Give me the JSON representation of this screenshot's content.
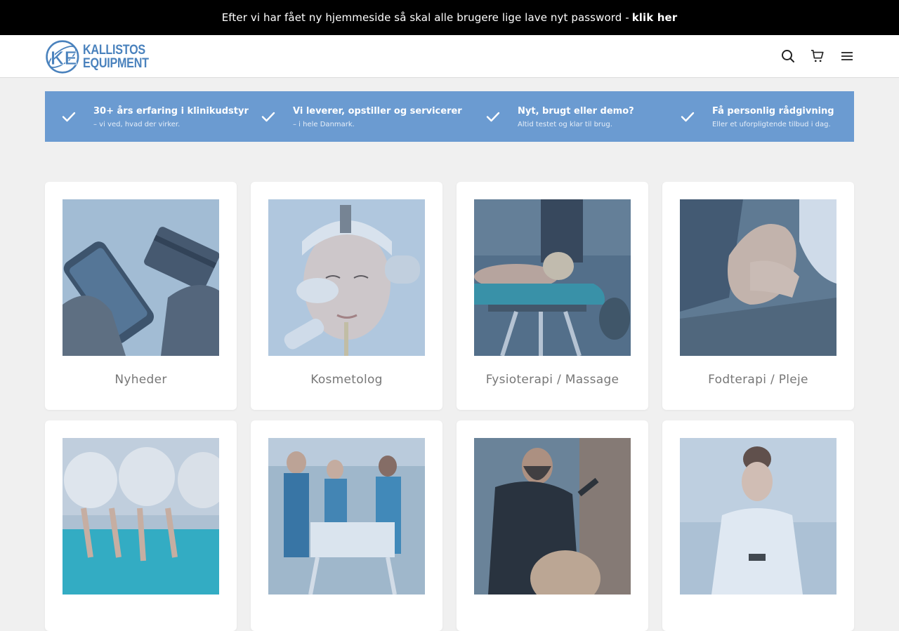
{
  "announcement": {
    "text": "Efter vi har fået ny hjemmeside så skal alle brugere lige lave nyt password - ",
    "link_label": "klik her"
  },
  "header": {
    "logo": {
      "line1": "KALLISTOS",
      "line2": "EQUIPMENT"
    },
    "icons": [
      "search-icon",
      "cart-icon",
      "menu-icon"
    ]
  },
  "usps": [
    {
      "title": "30+ års erfaring i klinikudstyr",
      "subtitle": "– vi ved, hvad der virker."
    },
    {
      "title": "Vi leverer, opstiller og servicerer",
      "subtitle": "– i hele Danmark."
    },
    {
      "title": "Nyt, brugt eller demo?",
      "subtitle": "Altid testet og klar til brug."
    },
    {
      "title": "Få personlig rådgivning",
      "subtitle": "Eller et uforpligtende tilbud i dag."
    }
  ],
  "categories": [
    {
      "label": "Nyheder"
    },
    {
      "label": "Kosmetolog"
    },
    {
      "label": "Fysioterapi / Massage"
    },
    {
      "label": "Fodterapi / Pleje"
    },
    {
      "label": ""
    },
    {
      "label": ""
    },
    {
      "label": ""
    },
    {
      "label": ""
    }
  ],
  "colors": {
    "brand": "#4a82bd",
    "usp_bar": "#6b9bd1",
    "announcement_bg": "#000000",
    "page_bg": "#f0f0f0"
  }
}
